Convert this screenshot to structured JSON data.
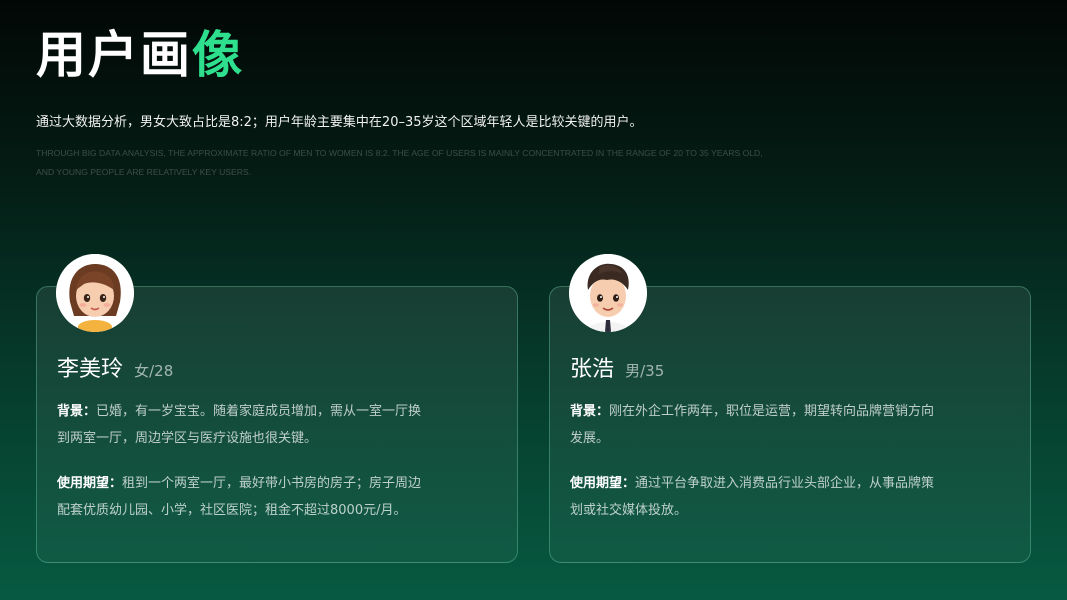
{
  "header": {
    "title_main": "用户画",
    "title_accent": "像",
    "subtitle_cn": "通过大数据分析，男女大致占比是8:2；用户年龄主要集中在20–35岁这个区域年轻人是比较关键的用户。",
    "subtitle_en": "THROUGH BIG DATA ANALYSIS, THE APPROXIMATE RATIO OF MEN TO WOMEN IS 8:2. THE AGE OF USERS IS MAINLY CONCENTRATED IN THE RANGE OF 20 TO 35 YEARS OLD, AND YOUNG PEOPLE ARE RELATIVELY KEY USERS."
  },
  "personas": [
    {
      "name": "李美玲",
      "meta": "女/28",
      "avatar_icon": "female-avatar-icon",
      "background_label": "背景：",
      "background_text": "已婚，有一岁宝宝。随着家庭成员增加，需从一室一厅换到两室一厅，周边学区与医疗设施也很关键。",
      "expectation_label": "使用期望：",
      "expectation_text": "租到一个两室一厅，最好带小书房的房子；房子周边配套优质幼儿园、小学，社区医院；租金不超过8000元/月。"
    },
    {
      "name": "张浩",
      "meta": "男/35",
      "avatar_icon": "male-avatar-icon",
      "background_label": "背景：",
      "background_text": "刚在外企工作两年，职位是运营，期望转向品牌营销方向发展。",
      "expectation_label": "使用期望：",
      "expectation_text": "通过平台争取进入消费品行业头部企业，从事品牌策划或社交媒体投放。"
    }
  ],
  "colors": {
    "accent": "#2ee08e",
    "card_border": "#78dcb4"
  }
}
